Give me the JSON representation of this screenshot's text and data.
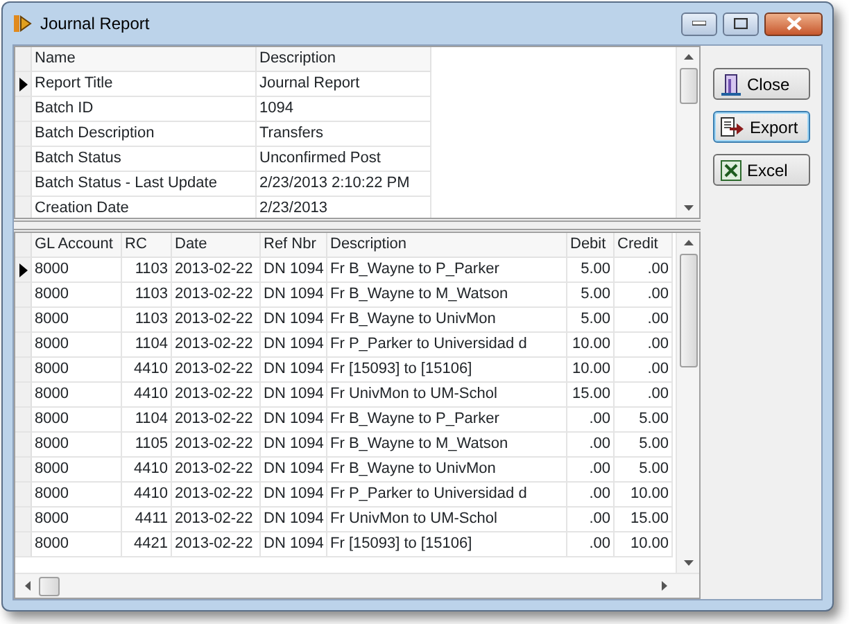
{
  "window": {
    "title": "Journal Report"
  },
  "properties": {
    "columns": [
      "Name",
      "Description"
    ],
    "rows": [
      {
        "current": true,
        "cells": [
          "Report Title",
          "Journal Report"
        ]
      },
      {
        "current": false,
        "cells": [
          "Batch ID",
          "1094"
        ]
      },
      {
        "current": false,
        "cells": [
          "Batch Description",
          "Transfers"
        ]
      },
      {
        "current": false,
        "cells": [
          "Batch Status",
          "Unconfirmed Post"
        ]
      },
      {
        "current": false,
        "cells": [
          "Batch Status - Last Update",
          "2/23/2013 2:10:22 PM"
        ]
      },
      {
        "current": false,
        "cells": [
          "Creation Date",
          "2/23/2013"
        ]
      }
    ]
  },
  "entries": {
    "columns": [
      "GL Account",
      "RC",
      "Date",
      "Ref Nbr",
      "Description",
      "Debit",
      "Credit"
    ],
    "rows": [
      {
        "current": true,
        "cells": [
          "8000",
          "1103",
          "2013-02-22",
          "DN 1094",
          "Fr B_Wayne to P_Parker",
          "5.00",
          ".00"
        ]
      },
      {
        "current": false,
        "cells": [
          "8000",
          "1103",
          "2013-02-22",
          "DN 1094",
          "Fr B_Wayne to M_Watson",
          "5.00",
          ".00"
        ]
      },
      {
        "current": false,
        "cells": [
          "8000",
          "1103",
          "2013-02-22",
          "DN 1094",
          "Fr B_Wayne to UnivMon",
          "5.00",
          ".00"
        ]
      },
      {
        "current": false,
        "cells": [
          "8000",
          "1104",
          "2013-02-22",
          "DN 1094",
          "Fr P_Parker to Universidad d",
          "10.00",
          ".00"
        ]
      },
      {
        "current": false,
        "cells": [
          "8000",
          "4410",
          "2013-02-22",
          "DN 1094",
          "Fr [15093] to [15106]",
          "10.00",
          ".00"
        ]
      },
      {
        "current": false,
        "cells": [
          "8000",
          "4410",
          "2013-02-22",
          "DN 1094",
          "Fr UnivMon to UM-Schol",
          "15.00",
          ".00"
        ]
      },
      {
        "current": false,
        "cells": [
          "8000",
          "1104",
          "2013-02-22",
          "DN 1094",
          "Fr B_Wayne to P_Parker",
          ".00",
          "5.00"
        ]
      },
      {
        "current": false,
        "cells": [
          "8000",
          "1105",
          "2013-02-22",
          "DN 1094",
          "Fr B_Wayne to M_Watson",
          ".00",
          "5.00"
        ]
      },
      {
        "current": false,
        "cells": [
          "8000",
          "4410",
          "2013-02-22",
          "DN 1094",
          "Fr B_Wayne to UnivMon",
          ".00",
          "5.00"
        ]
      },
      {
        "current": false,
        "cells": [
          "8000",
          "4410",
          "2013-02-22",
          "DN 1094",
          "Fr P_Parker to Universidad d",
          ".00",
          "10.00"
        ]
      },
      {
        "current": false,
        "cells": [
          "8000",
          "4411",
          "2013-02-22",
          "DN 1094",
          "Fr UnivMon to UM-Schol",
          ".00",
          "15.00"
        ]
      },
      {
        "current": false,
        "cells": [
          "8000",
          "4421",
          "2013-02-22",
          "DN 1094",
          "Fr [15093] to [15106]",
          ".00",
          "10.00"
        ]
      }
    ]
  },
  "buttons": [
    {
      "kind": "close",
      "label": "Close",
      "focused": false
    },
    {
      "kind": "export",
      "label": "Export",
      "focused": true
    },
    {
      "kind": "excel",
      "label": "Excel",
      "focused": false
    }
  ]
}
